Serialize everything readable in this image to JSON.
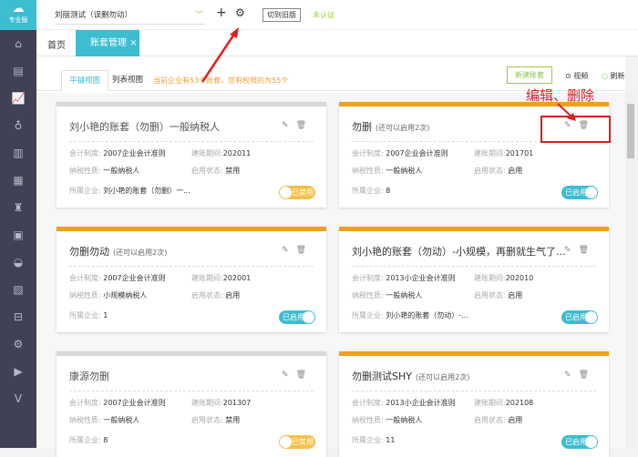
{
  "sidebar": {
    "logo_label": "专业版",
    "icons": [
      "home-icon",
      "voucher-icon",
      "chart-icon",
      "money-bag-icon",
      "document-icon",
      "report-icon",
      "shirt-icon",
      "image-icon",
      "bowl-icon",
      "tax-icon",
      "inbox-icon",
      "gear-icon",
      "video-icon",
      "v-icon"
    ]
  },
  "header": {
    "company": "刘丽测试（误删勿动）",
    "switch_old": "切到旧版",
    "unverified": "未认证"
  },
  "tabs": {
    "home": "首页",
    "active": "账套管理",
    "close": "×"
  },
  "toolbar": {
    "tile_view": "平铺视图",
    "list_view": "列表视图",
    "notice": "当前企业有53个账套，您有权限的为55个",
    "new_button": "新建账套",
    "video": "视频",
    "refresh": "刷新"
  },
  "annotation": "编辑、删除",
  "labels": {
    "system": "会计制度:",
    "period": "建账期间:",
    "tax": "纳税性质:",
    "status": "启用状态:",
    "company": "所属企业:"
  },
  "cards": [
    {
      "title": "刘小艳的账套（勿删）一般纳税人",
      "note": "",
      "system": "2007企业会计准则",
      "period": "202011",
      "tax": "一般纳税人",
      "status": "禁用",
      "company": "刘小艳的账套（勿删）一...",
      "toggle": "已禁用",
      "enabled": false
    },
    {
      "title": "勿删",
      "note": "(还可以启用2次)",
      "system": "2007企业会计准则",
      "period": "201701",
      "tax": "一般纳税人",
      "status": "启用",
      "company": "8",
      "toggle": "已启用",
      "enabled": true
    },
    {
      "title": "勿删勿动",
      "note": "(还可以启用2次)",
      "system": "2007企业会计准则",
      "period": "202001",
      "tax": "小规模纳税人",
      "status": "启用",
      "company": "1",
      "toggle": "已启用",
      "enabled": true
    },
    {
      "title": "刘小艳的账套（勿动）-小规模，再删就生气了...",
      "note": "",
      "system": "2013小企业会计准则",
      "period": "202010",
      "tax": "一般纳税人",
      "status": "启用",
      "company": "刘小艳的账套（勿动）-...",
      "toggle": "已启用",
      "enabled": true
    },
    {
      "title": "康源勿删",
      "note": "",
      "system": "2007企业会计准则",
      "period": "201307",
      "tax": "一般纳税人",
      "status": "禁用",
      "company": "8",
      "toggle": "已禁用",
      "enabled": false
    },
    {
      "title": "勿删测试SHY",
      "note": "(还可以启用2次)",
      "system": "2013小企业会计准则",
      "period": "202108",
      "tax": "一般纳税人",
      "status": "启用",
      "company": "11",
      "toggle": "已启用",
      "enabled": true
    }
  ]
}
